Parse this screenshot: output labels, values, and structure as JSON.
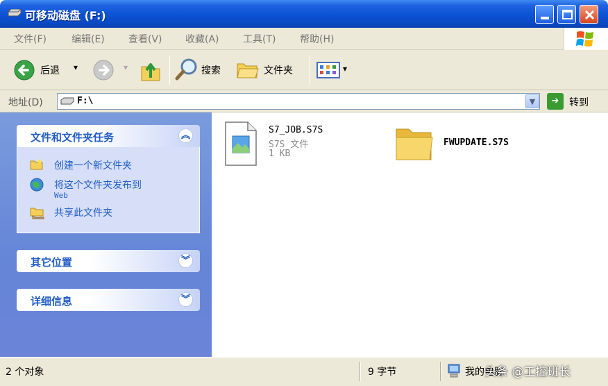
{
  "window": {
    "title": "可移动磁盘 (F:)"
  },
  "menu": [
    "文件(F)",
    "编辑(E)",
    "查看(V)",
    "收藏(A)",
    "工具(T)",
    "帮助(H)"
  ],
  "toolbar": {
    "back_label": "后退",
    "search_label": "搜索",
    "folders_label": "文件夹"
  },
  "address": {
    "label": "地址(D)",
    "value": "F:\\",
    "go_label": "转到"
  },
  "left_pane": {
    "tasks_title": "文件和文件夹任务",
    "tasks": [
      {
        "label": "创建一个新文件夹",
        "icon": "new-folder-icon"
      },
      {
        "label": "将这个文件夹发布到",
        "label2": "Web",
        "icon": "publish-web-icon"
      },
      {
        "label": "共享此文件夹",
        "icon": "share-folder-icon"
      }
    ],
    "other_places_title": "其它位置",
    "details_title": "详细信息"
  },
  "files": [
    {
      "name": "S7_JOB.S7S",
      "type": "S7S 文件",
      "size": "1 KB",
      "icon": "file-icon"
    },
    {
      "name": "FWUPDATE.S7S",
      "icon": "folder-icon"
    }
  ],
  "status": {
    "objects": "2 个对象",
    "bytes": "9 字节",
    "computer": "我的电脑",
    "watermark": "头条 @工控班长"
  },
  "colors": {
    "titlebar": "#0b52d4",
    "link": "#215dc6",
    "pane": "#6b84d8"
  }
}
